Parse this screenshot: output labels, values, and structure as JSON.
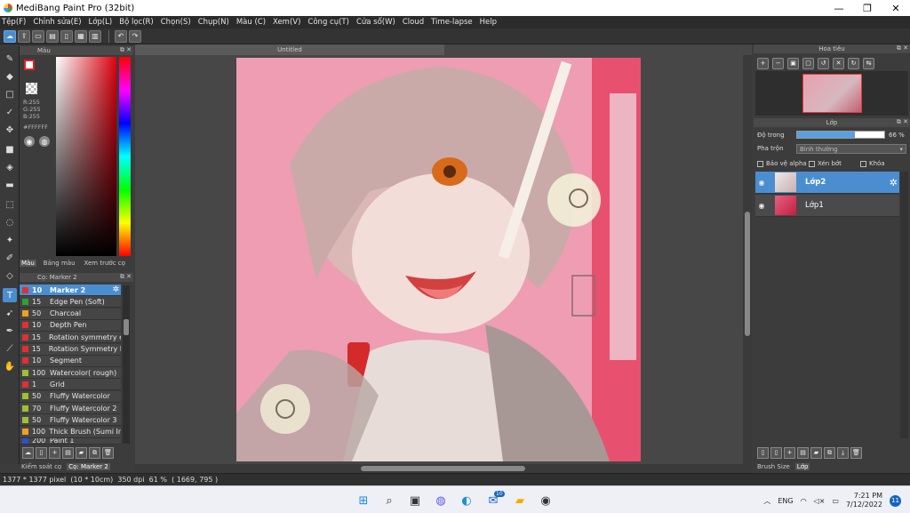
{
  "window": {
    "title": "MediBang Paint Pro (32bit)",
    "minimize": "—",
    "maximize": "❐",
    "close": "✕"
  },
  "menu": [
    "Tệp(F)",
    "Chỉnh sửa(E)",
    "Lớp(L)",
    "Bộ lọc(R)",
    "Chọn(S)",
    "Chụp(N)",
    "Màu (C)",
    "Xem(V)",
    "Công cụ(T)",
    "Cửa sổ(W)",
    "Cloud",
    "Time-lapse",
    "Help"
  ],
  "document": {
    "tab_title": "Untitled"
  },
  "color_panel": {
    "title": "Màu",
    "rgb": [
      "R:255",
      "G:255",
      "B:255"
    ],
    "hex": "#FFFFFF",
    "tabs": [
      "Màu",
      "Bảng màu",
      "Xem trước cọ"
    ],
    "fg_color": "#FFFFFF",
    "bg_color": "#DD2222"
  },
  "brush_panel": {
    "title": "Cọ: Marker 2",
    "brushes": [
      {
        "size": "10",
        "name": "Marker 2",
        "color": "#e03030"
      },
      {
        "size": "15",
        "name": "Edge Pen (Soft)",
        "color": "#30a030"
      },
      {
        "size": "50",
        "name": "Charcoal",
        "color": "#f0a020"
      },
      {
        "size": "10",
        "name": "Depth Pen",
        "color": "#e03030"
      },
      {
        "size": "15",
        "name": "Rotation symmetry e",
        "color": "#e03030"
      },
      {
        "size": "15",
        "name": "Rotation Symmetry E",
        "color": "#e03030"
      },
      {
        "size": "10",
        "name": "Segment",
        "color": "#e03030"
      },
      {
        "size": "100",
        "name": "Watercolor( rough)",
        "color": "#a0c030"
      },
      {
        "size": "1",
        "name": "Grid",
        "color": "#e03030"
      },
      {
        "size": "50",
        "name": "Fluffy Watercolor",
        "color": "#a0c030"
      },
      {
        "size": "70",
        "name": "Fluffy Watercolor 2",
        "color": "#a0c030"
      },
      {
        "size": "50",
        "name": "Fluffy Watercolor 3",
        "color": "#a0c030"
      },
      {
        "size": "100",
        "name": "Thick Brush (Sumi In",
        "color": "#f0a020"
      },
      {
        "size": "200",
        "name": "Paint 1",
        "color": "#3050d0"
      }
    ],
    "tabs": [
      "Kiểm soát cọ",
      "Cọ: Marker 2"
    ]
  },
  "navigator": {
    "title": "Hoa tiêu"
  },
  "layer_panel": {
    "title": "Lớp",
    "opacity_label": "Độ trong",
    "opacity_value": "66 %",
    "opacity": 0.66,
    "blend_label": "Pha trộn",
    "blend_value": "Bình thường",
    "checks": [
      "Bảo vệ alpha",
      "Xén bớt",
      "Khóa"
    ],
    "layers": [
      {
        "name": "Lớp2",
        "selected": true
      },
      {
        "name": "Lớp1",
        "selected": false
      }
    ]
  },
  "right_tabs": [
    "Brush Size",
    "Lớp"
  ],
  "status": {
    "size": "1377 * 1377 pixel",
    "physical": "(10 * 10cm)",
    "dpi": "350 dpi",
    "zoom": "61 %",
    "coords": "( 1669, 795 )"
  },
  "taskbar": {
    "lang": "ENG",
    "time": "7:21 PM",
    "date": "7/12/2022",
    "notifications": "11",
    "mail_badge": "10"
  }
}
